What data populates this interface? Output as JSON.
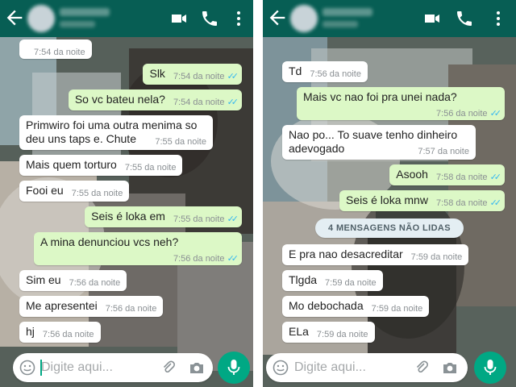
{
  "colors": {
    "header": "#075e54",
    "outgoing_bubble": "#dcf8c6",
    "incoming_bubble": "#ffffff",
    "read_ticks": "#34b7f1",
    "mic_button": "#00a884"
  },
  "icons": [
    "back-arrow-icon",
    "video-call-icon",
    "phone-icon",
    "more-options-icon",
    "emoji-icon",
    "attach-icon",
    "camera-icon",
    "mic-icon",
    "read-receipt-icon"
  ],
  "left": {
    "input_placeholder": "Digite aqui...",
    "messages": [
      {
        "dir": "in",
        "text": "",
        "time": "7:54 da noite"
      },
      {
        "dir": "out",
        "text": "Slk",
        "time": "7:54 da noite",
        "read": true
      },
      {
        "dir": "out",
        "text": "So vc bateu nela?",
        "time": "7:54 da noite",
        "read": true
      },
      {
        "dir": "in",
        "text": "Primwiro foi uma outra menima so deu uns taps e. Chute",
        "time": "7:55 da noite"
      },
      {
        "dir": "in",
        "text": "Mais quem torturo",
        "time": "7:55 da noite"
      },
      {
        "dir": "in",
        "text": "Fooi eu",
        "time": "7:55 da noite"
      },
      {
        "dir": "out",
        "text": "Seis é loka em",
        "time": "7:55 da noite",
        "read": true
      },
      {
        "dir": "out",
        "text": "A mina denunciou vcs neh?",
        "time": "7:56 da noite",
        "read": true
      },
      {
        "dir": "in",
        "text": "Sim eu",
        "time": "7:56 da noite"
      },
      {
        "dir": "in",
        "text": "Me apresentei",
        "time": "7:56 da noite"
      },
      {
        "dir": "in",
        "text": "hj",
        "time": "7:56 da noite"
      }
    ]
  },
  "right": {
    "input_placeholder": "Digite aqui...",
    "unread_banner": "4 MENSAGENS NÃO LIDAS",
    "messages": [
      {
        "dir": "in",
        "text": "Td",
        "time": "7:56 da noite"
      },
      {
        "dir": "out",
        "text": "Mais vc nao foi pra unei nada?",
        "time": "7:56 da noite",
        "read": true
      },
      {
        "dir": "in",
        "text": "Nao po... To suave tenho dinheiro adevogado",
        "time": "7:57 da noite"
      },
      {
        "dir": "out",
        "text": "Asooh",
        "time": "7:58 da noite",
        "read": true
      },
      {
        "dir": "out",
        "text": "Seis é loka mnw",
        "time": "7:58 da noite",
        "read": true
      },
      {
        "dir": "in",
        "text": "E pra nao desacreditar",
        "time": "7:59 da noite"
      },
      {
        "dir": "in",
        "text": "Tlgda",
        "time": "7:59 da noite"
      },
      {
        "dir": "in",
        "text": "Mo debochada",
        "time": "7:59 da noite"
      },
      {
        "dir": "in",
        "text": "ELa",
        "time": "7:59 da noite"
      }
    ]
  }
}
